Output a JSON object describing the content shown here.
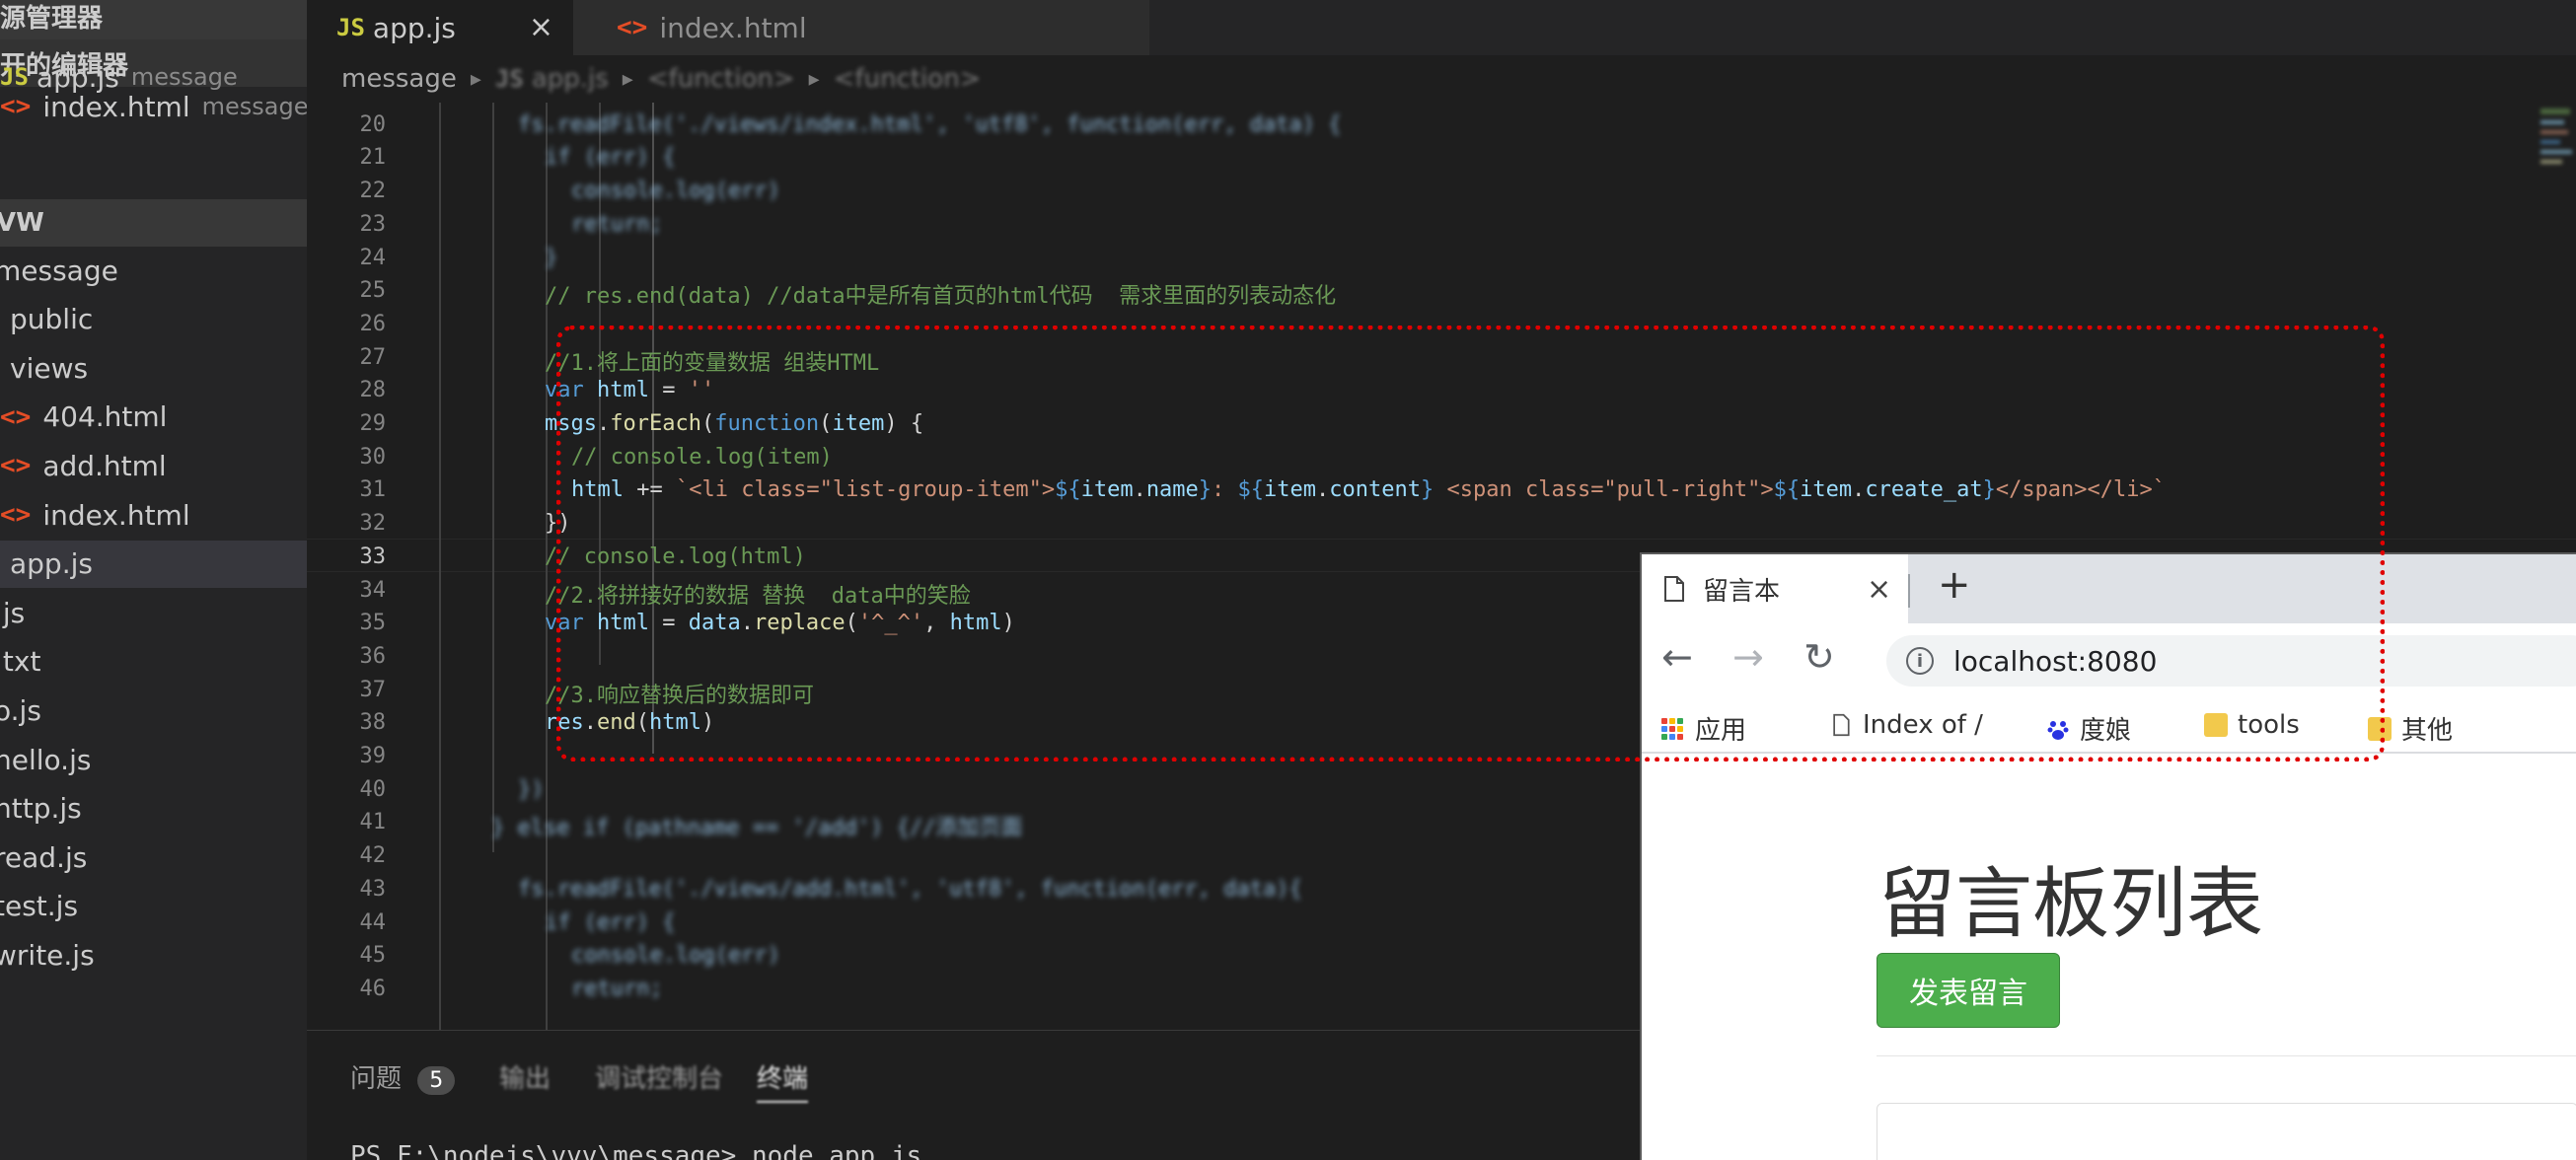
{
  "sidebar": {
    "title": "资源管理器",
    "open_editors_label": "打开的编辑器",
    "open_editors": [
      {
        "icon": "JS",
        "name": "app.js",
        "desc": "message"
      },
      {
        "icon": "<>",
        "name": "index.html",
        "desc": "message..."
      }
    ],
    "workspace_label": "VW",
    "tree": [
      {
        "name": "message",
        "indent": 0
      },
      {
        "name": "public",
        "indent": 1
      },
      {
        "name": "views",
        "indent": 1
      },
      {
        "name": "404.html",
        "indent": 2,
        "icon": "<>"
      },
      {
        "name": "add.html",
        "indent": 2,
        "icon": "<>"
      },
      {
        "name": "index.html",
        "indent": 2,
        "icon": "<>"
      },
      {
        "name": "app.js",
        "indent": 1,
        "active": true
      },
      {
        "name": ".js",
        "indent": 0
      },
      {
        "name": ".txt",
        "indent": 0
      },
      {
        "name": "o.js",
        "indent": 0
      },
      {
        "name": "hello.js",
        "indent": 0
      },
      {
        "name": "http.js",
        "indent": 0
      },
      {
        "name": "read.js",
        "indent": 0
      },
      {
        "name": "test.js",
        "indent": 0
      },
      {
        "name": "write.js",
        "indent": 0
      }
    ]
  },
  "tabs": {
    "app": {
      "icon": "JS",
      "label": "app.js",
      "close": "×"
    },
    "index": {
      "icon": "<>",
      "label": "index.html"
    }
  },
  "breadcrumb": {
    "items": [
      "message",
      "app.js",
      "<function>",
      "<function>"
    ]
  },
  "editor": {
    "active_line": 33,
    "lines": [
      {
        "n": 20,
        "text": "fs.readFile('./views/index.html', 'utf8', function(err, data) {",
        "indent": 4,
        "blur": true
      },
      {
        "n": 21,
        "text": "if (err) {",
        "indent": 5,
        "blur": true
      },
      {
        "n": 22,
        "text": "console.log(err)",
        "indent": 6,
        "blur": true
      },
      {
        "n": 23,
        "text": "return;",
        "indent": 6,
        "blur": true
      },
      {
        "n": 24,
        "text": "}",
        "indent": 5,
        "blur": true
      },
      {
        "n": 25,
        "text": "// res.end(data) //data中是所有首页的html代码  需求里面的列表动态化",
        "indent": 5,
        "cls": "c-com"
      },
      {
        "n": 26,
        "text": "",
        "indent": 5
      },
      {
        "n": 27,
        "text": "//1.将上面的变量数据 组装HTML",
        "indent": 5,
        "cls": "c-com"
      },
      {
        "n": 28,
        "parts": [
          {
            "t": "var ",
            "c": "c-kw"
          },
          {
            "t": "html",
            "c": "c-var"
          },
          {
            "t": " = ",
            "c": ""
          },
          {
            "t": "''",
            "c": "c-str"
          }
        ],
        "indent": 5
      },
      {
        "n": 29,
        "parts": [
          {
            "t": "msgs",
            "c": "c-var"
          },
          {
            "t": ".",
            "c": ""
          },
          {
            "t": "forEach",
            "c": "c-fn"
          },
          {
            "t": "(",
            "c": ""
          },
          {
            "t": "function",
            "c": "c-kw"
          },
          {
            "t": "(",
            "c": ""
          },
          {
            "t": "item",
            "c": "c-var"
          },
          {
            "t": ") {",
            "c": ""
          }
        ],
        "indent": 5
      },
      {
        "n": 30,
        "text": "// console.log(item)",
        "indent": 6,
        "cls": "c-com"
      },
      {
        "n": 31,
        "parts": [
          {
            "t": "html",
            "c": "c-var"
          },
          {
            "t": " += ",
            "c": ""
          },
          {
            "t": "`<li class=\"list-group-item\">",
            "c": "c-str"
          },
          {
            "t": "${",
            "c": "c-kw"
          },
          {
            "t": "item",
            "c": "c-var"
          },
          {
            "t": ".",
            "c": ""
          },
          {
            "t": "name",
            "c": "c-var"
          },
          {
            "t": "}",
            "c": "c-kw"
          },
          {
            "t": ": ",
            "c": "c-str"
          },
          {
            "t": "${",
            "c": "c-kw"
          },
          {
            "t": "item",
            "c": "c-var"
          },
          {
            "t": ".",
            "c": ""
          },
          {
            "t": "content",
            "c": "c-var"
          },
          {
            "t": "}",
            "c": "c-kw"
          },
          {
            "t": " <span class=\"pull-right\">",
            "c": "c-str"
          },
          {
            "t": "${",
            "c": "c-kw"
          },
          {
            "t": "item",
            "c": "c-var"
          },
          {
            "t": ".",
            "c": ""
          },
          {
            "t": "create_at",
            "c": "c-var"
          },
          {
            "t": "}",
            "c": "c-kw"
          },
          {
            "t": "</span></li>`",
            "c": "c-str"
          }
        ],
        "indent": 6
      },
      {
        "n": 32,
        "text": "})",
        "indent": 5
      },
      {
        "n": 33,
        "text": "// console.log(html)",
        "indent": 5,
        "cls": "c-com"
      },
      {
        "n": 34,
        "text": "//2.将拼接好的数据 替换  data中的笑脸",
        "indent": 5,
        "cls": "c-com"
      },
      {
        "n": 35,
        "parts": [
          {
            "t": "var ",
            "c": "c-kw"
          },
          {
            "t": "html",
            "c": "c-var"
          },
          {
            "t": " = ",
            "c": ""
          },
          {
            "t": "data",
            "c": "c-var"
          },
          {
            "t": ".",
            "c": ""
          },
          {
            "t": "replace",
            "c": "c-fn"
          },
          {
            "t": "(",
            "c": ""
          },
          {
            "t": "'^_^'",
            "c": "c-str"
          },
          {
            "t": ", ",
            "c": ""
          },
          {
            "t": "html",
            "c": "c-var"
          },
          {
            "t": ")",
            "c": ""
          }
        ],
        "indent": 5
      },
      {
        "n": 36,
        "text": "",
        "indent": 5
      },
      {
        "n": 37,
        "text": "//3.响应替换后的数据即可",
        "indent": 5,
        "cls": "c-com"
      },
      {
        "n": 38,
        "parts": [
          {
            "t": "res",
            "c": "c-var"
          },
          {
            "t": ".",
            "c": ""
          },
          {
            "t": "end",
            "c": "c-fn"
          },
          {
            "t": "(",
            "c": ""
          },
          {
            "t": "html",
            "c": "c-var"
          },
          {
            "t": ")",
            "c": ""
          }
        ],
        "indent": 5
      },
      {
        "n": 39,
        "text": "",
        "indent": 5
      },
      {
        "n": 40,
        "text": "})",
        "indent": 4,
        "blur": true
      },
      {
        "n": 41,
        "text": "} else if (pathname == '/add') {//添加页面",
        "indent": 3,
        "blur": true
      },
      {
        "n": 42,
        "text": "",
        "indent": 4
      },
      {
        "n": 43,
        "text": "fs.readFile('./views/add.html', 'utf8', function(err, data){",
        "indent": 4,
        "blur": true
      },
      {
        "n": 44,
        "text": "if (err) {",
        "indent": 5,
        "blur": true
      },
      {
        "n": 45,
        "text": "console.log(err)",
        "indent": 6,
        "blur": true
      },
      {
        "n": 46,
        "text": "return;",
        "indent": 6,
        "blur": true
      }
    ]
  },
  "panel": {
    "problems_label": "问题",
    "problems_count": "5",
    "output_label": "输出",
    "debug_label": "调试控制台",
    "terminal_label": "终端",
    "terminal_line": "PS F:\\nodejs\\vvv\\message> node app.js"
  },
  "browser": {
    "tab_title": "留言本",
    "tab_close": "×",
    "new_tab": "+",
    "back": "←",
    "forward": "→",
    "reload": "↻",
    "info_glyph": "i",
    "url": "localhost:8080",
    "bookmarks": [
      {
        "label": "应用",
        "icon": "apps-icon"
      },
      {
        "label": "Index of /",
        "icon": "page-icon"
      },
      {
        "label": "度娘",
        "icon": "baidu-icon"
      },
      {
        "label": "tools",
        "icon": "folder-icon"
      },
      {
        "label": "其他",
        "icon": "folder-icon"
      }
    ],
    "page_title": "留言板列表",
    "post_button": "发表留言"
  },
  "colors": {
    "annotation": "#e00000",
    "button_green": "#4cae4c",
    "js_icon": "#cbcb41",
    "html_icon": "#e44d26"
  }
}
